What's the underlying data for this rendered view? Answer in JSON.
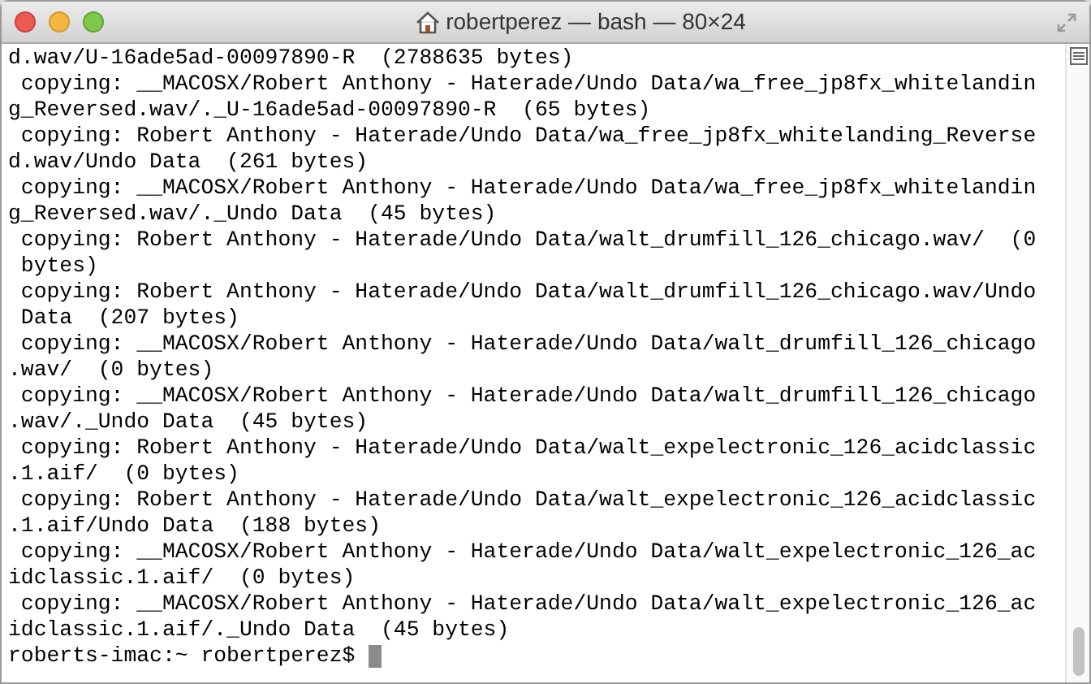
{
  "window": {
    "title": "robertperez — bash — 80×24"
  },
  "terminal": {
    "lines": [
      "d.wav/U-16ade5ad-00097890-R  (2788635 bytes)",
      " copying: __MACOSX/Robert Anthony - Haterade/Undo Data/wa_free_jp8fx_whitelandin",
      "g_Reversed.wav/._U-16ade5ad-00097890-R  (65 bytes)",
      " copying: Robert Anthony - Haterade/Undo Data/wa_free_jp8fx_whitelanding_Reverse",
      "d.wav/Undo Data  (261 bytes)",
      " copying: __MACOSX/Robert Anthony - Haterade/Undo Data/wa_free_jp8fx_whitelandin",
      "g_Reversed.wav/._Undo Data  (45 bytes)",
      " copying: Robert Anthony - Haterade/Undo Data/walt_drumfill_126_chicago.wav/  (0",
      " bytes)",
      " copying: Robert Anthony - Haterade/Undo Data/walt_drumfill_126_chicago.wav/Undo",
      " Data  (207 bytes)",
      " copying: __MACOSX/Robert Anthony - Haterade/Undo Data/walt_drumfill_126_chicago",
      ".wav/  (0 bytes)",
      " copying: __MACOSX/Robert Anthony - Haterade/Undo Data/walt_drumfill_126_chicago",
      ".wav/._Undo Data  (45 bytes)",
      " copying: Robert Anthony - Haterade/Undo Data/walt_expelectronic_126_acidclassic",
      ".1.aif/  (0 bytes)",
      " copying: Robert Anthony - Haterade/Undo Data/walt_expelectronic_126_acidclassic",
      ".1.aif/Undo Data  (188 bytes)",
      " copying: __MACOSX/Robert Anthony - Haterade/Undo Data/walt_expelectronic_126_ac",
      "idclassic.1.aif/  (0 bytes)",
      " copying: __MACOSX/Robert Anthony - Haterade/Undo Data/walt_expelectronic_126_ac",
      "idclassic.1.aif/._Undo Data  (45 bytes)"
    ],
    "prompt": "roberts-imac:~ robertperez$"
  }
}
